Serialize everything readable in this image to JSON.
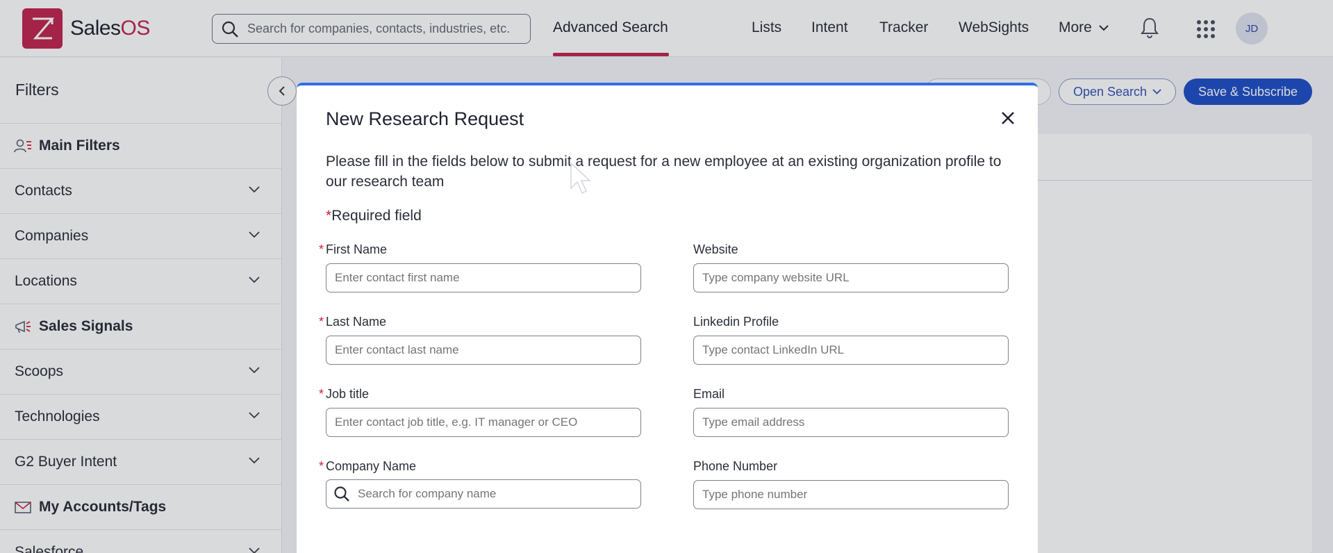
{
  "app": {
    "logo_letter": "Z",
    "logo_name_prefix": "Sales",
    "logo_name_suffix": "OS",
    "brand_color": "#c0264f"
  },
  "header": {
    "search_placeholder": "Search for companies, contacts, industries, etc.",
    "active_tab": "Advanced Search",
    "nav": [
      "Lists",
      "Intent",
      "Tracker",
      "WebSights",
      "More"
    ],
    "avatar_initials": "JD",
    "icons": [
      "search-icon",
      "bell-icon",
      "apps-grid-icon",
      "chevron-down-icon"
    ]
  },
  "sidebar": {
    "title": "Filters",
    "items": [
      {
        "label": "Main Filters",
        "icon": "user-filter-icon",
        "bold": true
      },
      {
        "label": "Contacts",
        "expandable": true
      },
      {
        "label": "Companies",
        "expandable": true
      },
      {
        "label": "Locations",
        "expandable": true
      },
      {
        "label": "Sales Signals",
        "icon": "megaphone-icon",
        "bold": true
      },
      {
        "label": "Scoops",
        "expandable": true
      },
      {
        "label": "Technologies",
        "expandable": true
      },
      {
        "label": "G2 Buyer Intent",
        "expandable": true
      },
      {
        "label": "My Accounts/Tags",
        "icon": "mail-tag-icon",
        "bold": true
      },
      {
        "label": "Salesforce",
        "expandable": true
      }
    ]
  },
  "toolbar": {
    "open_search_label": "Open Search",
    "save_subscribe_label": "Save & Subscribe"
  },
  "modal": {
    "title": "New Research Request",
    "description": "Please fill in the fields below to submit a request for a new employee at an existing organization profile to our research team",
    "required_note": "Required field",
    "fields": {
      "first_name": {
        "label": "First Name",
        "placeholder": "Enter contact first name",
        "required": true
      },
      "last_name": {
        "label": "Last Name",
        "placeholder": "Enter contact last name",
        "required": true
      },
      "job_title": {
        "label": "Job title",
        "placeholder": "Enter contact job title, e.g. IT manager or CEO",
        "required": true
      },
      "company_name": {
        "label": "Company Name",
        "placeholder": "Search for company name",
        "required": true
      },
      "website": {
        "label": "Website",
        "placeholder": "Type company website URL",
        "required": false
      },
      "linkedin": {
        "label": "Linkedin Profile",
        "placeholder": "Type contact LinkedIn URL",
        "required": false
      },
      "email": {
        "label": "Email",
        "placeholder": "Type email address",
        "required": false
      },
      "phone": {
        "label": "Phone Number",
        "placeholder": "Type phone number",
        "required": false
      }
    }
  }
}
